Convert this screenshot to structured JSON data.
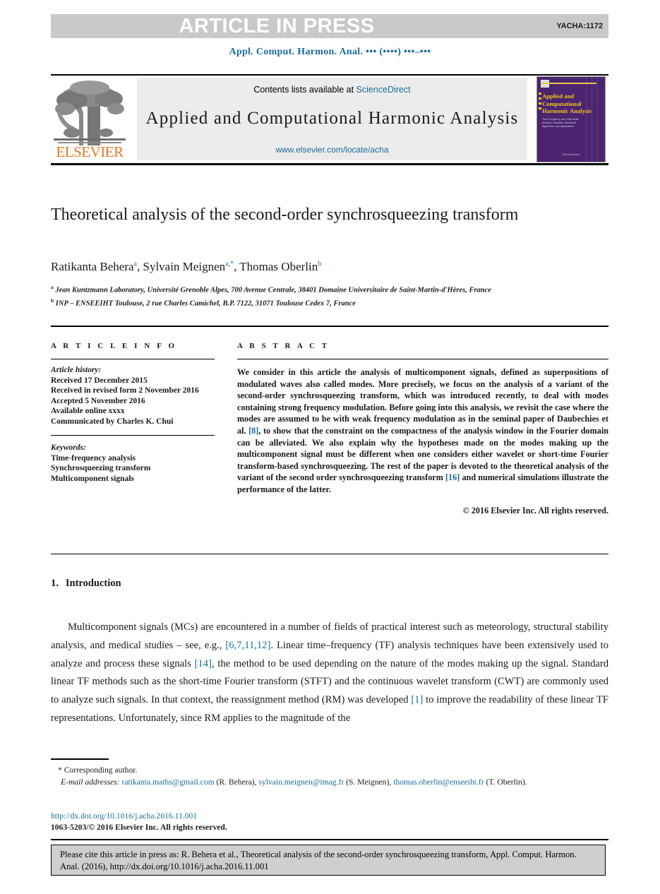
{
  "banner": {
    "text": "ARTICLE IN PRESS",
    "code": "YACHA:1172",
    "bg_color": "#c9c9c9",
    "text_color": "#ffffff"
  },
  "running_head": "Appl. Comput. Harmon. Anal. ••• (••••) •••–•••",
  "masthead": {
    "contents_prefix": "Contents lists available at ",
    "contents_link": "ScienceDirect",
    "journal_title": "Applied and Computational Harmonic Analysis",
    "journal_url": "www.elsevier.com/locate/acha",
    "publisher_wordmark": "ELSEVIER",
    "publisher_color": "#e87722",
    "link_color": "#1a6b9a",
    "cover": {
      "title": "Applied and Computational Harmonic Analysis",
      "subtitle": "Time-Frequency and Time-Scale Analysis, Wavelets, Numerical Algorithms, and Applications",
      "footer": "ScienceDirect",
      "background": "#4b2470",
      "title_color": "#f0c419"
    }
  },
  "article": {
    "title": "Theoretical analysis of the second-order synchrosqueezing transform",
    "authors": [
      {
        "name": "Ratikanta Behera",
        "marks": "a"
      },
      {
        "name": "Sylvain Meignen",
        "marks": "a,*"
      },
      {
        "name": "Thomas Oberlin",
        "marks": "b"
      }
    ],
    "affiliations": [
      {
        "mark": "a",
        "text": "Jean Kuntzmann Laboratory, Université Grenoble Alpes, 700 Avenue Centrale, 38401 Domaine Universitaire de Saint-Martin-d'Hères, France"
      },
      {
        "mark": "b",
        "text": "INP – ENSEEIHT Toulouse, 2 rue Charles Camichel, B.P. 7122, 31071 Toulouse Cedex 7, France"
      }
    ]
  },
  "info": {
    "heading": "A R T I C L E   I N F O",
    "history_label": "Article history:",
    "history": [
      "Received 17 December 2015",
      "Received in revised form 2 November 2016",
      "Accepted 5 November 2016",
      "Available online xxxx",
      "Communicated by Charles K. Chui"
    ],
    "keywords_label": "Keywords:",
    "keywords": [
      "Time-frequency analysis",
      "Synchrosqueezing transform",
      "Multicomponent signals"
    ]
  },
  "abstract": {
    "heading": "A B S T R A C T",
    "part1": "We consider in this article the analysis of multicomponent signals, defined as superpositions of modulated waves also called modes. More precisely, we focus on the analysis of a variant of the second-order synchrosqueezing transform, which was introduced recently, to deal with modes containing strong frequency modulation. Before going into this analysis, we revisit the case where the modes are assumed to be with weak frequency modulation as in the seminal paper of Daubechies et al. ",
    "ref1": "[8]",
    "part2": ", to show that the constraint on the compactness of the analysis window in the Fourier domain can be alleviated. We also explain why the hypotheses made on the modes making up the multicomponent signal must be different when one considers either wavelet or short-time Fourier transform-based synchrosqueezing. The rest of the paper is devoted to the theoretical analysis of the variant of the second order synchrosqueezing transform ",
    "ref2": "[16]",
    "part3": " and numerical simulations illustrate the performance of the latter.",
    "copyright": "© 2016 Elsevier Inc. All rights reserved."
  },
  "section": {
    "number": "1.",
    "title": "Introduction",
    "para1_a": "Multicomponent signals (MCs) are encountered in a number of fields of practical interest such as meteorology, structural stability analysis, and medical studies – see, e.g., ",
    "para1_ref1": "[6,7,11,12]",
    "para1_b": ". Linear time–frequency (TF) analysis techniques have been extensively used to analyze and process these signals ",
    "para1_ref2": "[14]",
    "para1_c": ", the method to be used depending on the nature of the modes making up the signal. Standard linear TF methods such as the short-time Fourier transform (STFT) and the continuous wavelet transform (CWT) are commonly used to analyze such signals. In that context, the reassignment method (RM) was developed ",
    "para1_ref3": "[1]",
    "para1_d": " to improve the readability of these linear TF representations. Unfortunately, since RM applies to the magnitude of the"
  },
  "footnotes": {
    "corresponding": "*  Corresponding author.",
    "email_label": "E-mail addresses:",
    "emails": [
      {
        "address": "ratikanta.maths@gmail.com",
        "person": "(R. Behera),"
      },
      {
        "address": "sylvain.meignen@imag.fr",
        "person": "(S. Meignen),"
      },
      {
        "address": "thomas.oberlin@enseeiht.fr",
        "person": "(T. Oberlin)."
      }
    ],
    "doi": "http://dx.doi.org/10.1016/j.acha.2016.11.001",
    "issn_line": "1063-5203/© 2016 Elsevier Inc. All rights reserved."
  },
  "cite_box": {
    "text": "Please cite this article in press as: R. Behera et al., Theoretical analysis of the second-order synchrosqueezing transform, Appl. Comput. Harmon. Anal. (2016), http://dx.doi.org/10.1016/j.acha.2016.11.001",
    "bg_color": "#cfcfcf"
  }
}
